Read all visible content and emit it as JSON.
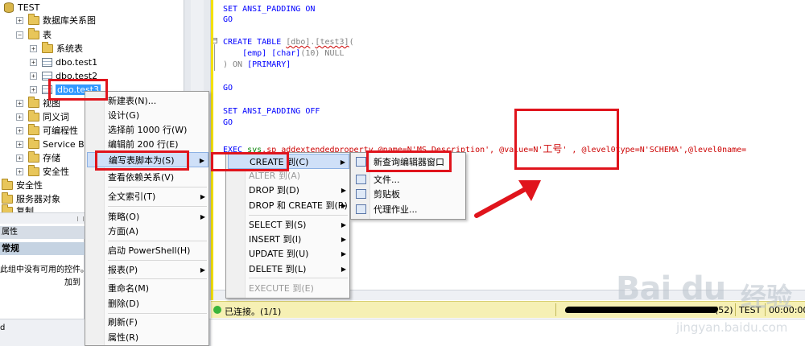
{
  "object_explorer": {
    "items": [
      {
        "label": "TEST",
        "expander": "−",
        "icon": "database"
      },
      {
        "label": "数据库关系图",
        "expander": "+",
        "icon": "folder"
      },
      {
        "label": "表",
        "expander": "−",
        "icon": "folder"
      },
      {
        "label": "系统表",
        "expander": "+",
        "icon": "folder"
      },
      {
        "label": "dbo.test1",
        "expander": "+",
        "icon": "table"
      },
      {
        "label": "dbo.test2",
        "expander": "+",
        "icon": "table"
      },
      {
        "label": "dbo.test3",
        "expander": "+",
        "icon": "table"
      },
      {
        "label": "视图",
        "expander": "+",
        "icon": "folder"
      },
      {
        "label": "同义词",
        "expander": "+",
        "icon": "folder"
      },
      {
        "label": "可编程性",
        "expander": "+",
        "icon": "folder"
      },
      {
        "label": "Service Bro",
        "expander": "+",
        "icon": "folder"
      },
      {
        "label": "存储",
        "expander": "+",
        "icon": "folder"
      },
      {
        "label": "安全性",
        "expander": "+",
        "icon": "folder"
      },
      {
        "label": "安全性",
        "expander": "+",
        "icon": "folder"
      },
      {
        "label": "服务器对象",
        "expander": "+",
        "icon": "folder"
      },
      {
        "label": "复制",
        "expander": "+",
        "icon": "folder"
      }
    ]
  },
  "properties": {
    "title": "属性",
    "section": "常规",
    "message_line1": "此组中没有可用的控件。",
    "message_line2": "加到"
  },
  "editor": {
    "lines": {
      "l1": "SET ANSI_PADDING ON",
      "l2": "GO",
      "l3_a": "CREATE TABLE ",
      "l3_b": "[dbo]",
      "l3_c": ".",
      "l3_d": "[test3]",
      "l3_e": "(",
      "l4_a": "    [emp] [char]",
      "l4_b": "(10) NULL",
      "l5_a": ") ON ",
      "l5_b": "[PRIMARY]",
      "l6": "GO",
      "l7": "SET ANSI_PADDING OFF",
      "l8": "GO",
      "l9_a": "EXEC ",
      "l9_b": "sys",
      "l9_c": ".sp_addextendedproperty @name=N'MS_Description', @value=N'",
      "l9_d": "工号",
      "l9_e": "' , @level0type=N'SCHEMA',@level0name="
    },
    "outline_marker": "−"
  },
  "context_menu": {
    "items": [
      "新建表(N)...",
      "设计(G)",
      "选择前 1000 行(W)",
      "编辑前 200 行(E)",
      "编写表脚本为(S)",
      "查看依赖关系(V)",
      "全文索引(T)",
      "策略(O)",
      "方面(A)",
      "启动 PowerShell(H)",
      "报表(P)",
      "重命名(M)",
      "删除(D)",
      "刷新(F)",
      "属性(R)"
    ]
  },
  "script_submenu": {
    "items": [
      "CREATE 到(C)",
      "ALTER 到(A)",
      "DROP 到(D)",
      "DROP 和 CREATE 到(R)",
      "SELECT 到(S)",
      "INSERT 到(I)",
      "UPDATE 到(U)",
      "DELETE 到(L)",
      "EXECUTE 到(E)"
    ]
  },
  "create_submenu": {
    "items": [
      "新查询编辑器窗口",
      "文件...",
      "剪贴板",
      "代理作业..."
    ]
  },
  "statusbar": {
    "connected": "已连接。(1/1)",
    "rows": "(52)",
    "database": "TEST",
    "elapsed": "00:00:00"
  },
  "bottom": {
    "label": "d"
  },
  "watermark": {
    "logo": "Bai du",
    "cn": "经验",
    "url": "jingyan.baidu.com"
  },
  "colors": {
    "annotation_red": "#e0141c",
    "selection_blue": "#3399ff",
    "sql_keyword": "#0000ff",
    "sql_string": "#cc0000",
    "statusbar_bg": "#f6f0b4"
  }
}
